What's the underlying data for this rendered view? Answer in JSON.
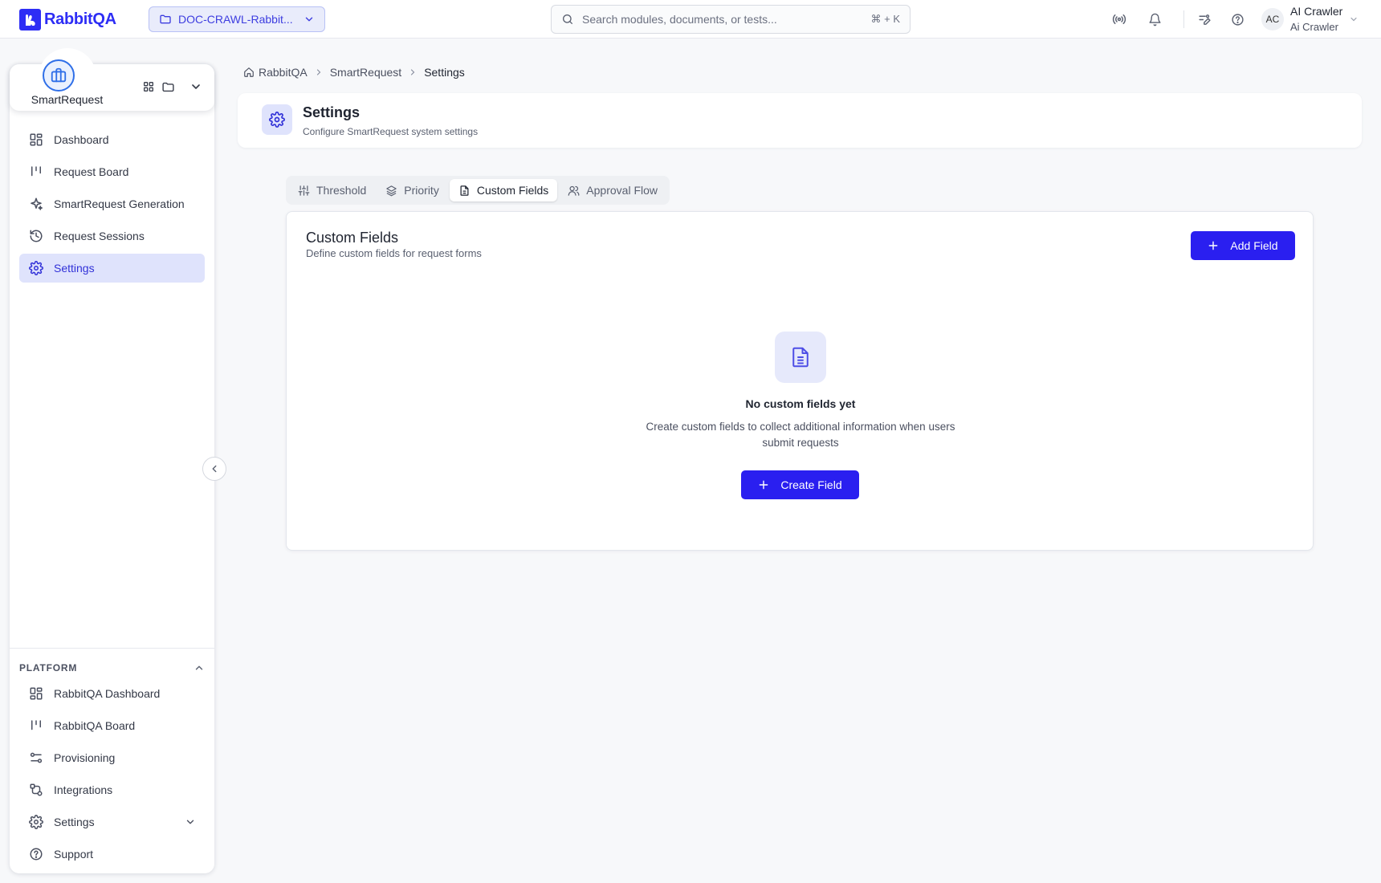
{
  "app": {
    "logo_text": "RabbitQA"
  },
  "project_selector": {
    "label": "DOC-CRAWL-Rabbit..."
  },
  "search": {
    "placeholder": "Search modules, documents, or tests...",
    "shortcut": "⌘ + K"
  },
  "user": {
    "initials": "AC",
    "name": "AI Crawler",
    "subtitle": "Ai Crawler"
  },
  "sidebar": {
    "module_name": "SmartRequest",
    "items": [
      {
        "label": "Dashboard",
        "icon": "dashboard-icon"
      },
      {
        "label": "Request Board",
        "icon": "board-icon"
      },
      {
        "label": "SmartRequest Generation",
        "icon": "sparkles-icon"
      },
      {
        "label": "Request Sessions",
        "icon": "history-icon"
      },
      {
        "label": "Settings",
        "icon": "gear-icon",
        "active": true
      }
    ],
    "platform_label": "PLATFORM",
    "platform_items": [
      {
        "label": "RabbitQA Dashboard",
        "icon": "dashboard-icon"
      },
      {
        "label": "RabbitQA Board",
        "icon": "board-icon"
      },
      {
        "label": "Provisioning",
        "icon": "sliders-icon"
      },
      {
        "label": "Integrations",
        "icon": "route-icon"
      },
      {
        "label": "Settings",
        "icon": "gear-icon"
      },
      {
        "label": "Support",
        "icon": "help-circle-icon"
      }
    ]
  },
  "breadcrumb": [
    "RabbitQA",
    "SmartRequest",
    "Settings"
  ],
  "page": {
    "title": "Settings",
    "subtitle": "Configure SmartRequest system settings"
  },
  "tabs": [
    {
      "label": "Threshold"
    },
    {
      "label": "Priority"
    },
    {
      "label": "Custom Fields",
      "active": true
    },
    {
      "label": "Approval Flow"
    }
  ],
  "custom_fields": {
    "title": "Custom Fields",
    "subtitle": "Define custom fields for request forms",
    "add_button": "Add Field",
    "empty_title": "No custom fields yet",
    "empty_text": "Create custom fields to collect additional information when users submit requests",
    "create_button": "Create Field"
  },
  "colors": {
    "brand": "#2d2df5",
    "primary_button": "#2a1ff0",
    "active_nav_bg": "#dfe3fc"
  }
}
